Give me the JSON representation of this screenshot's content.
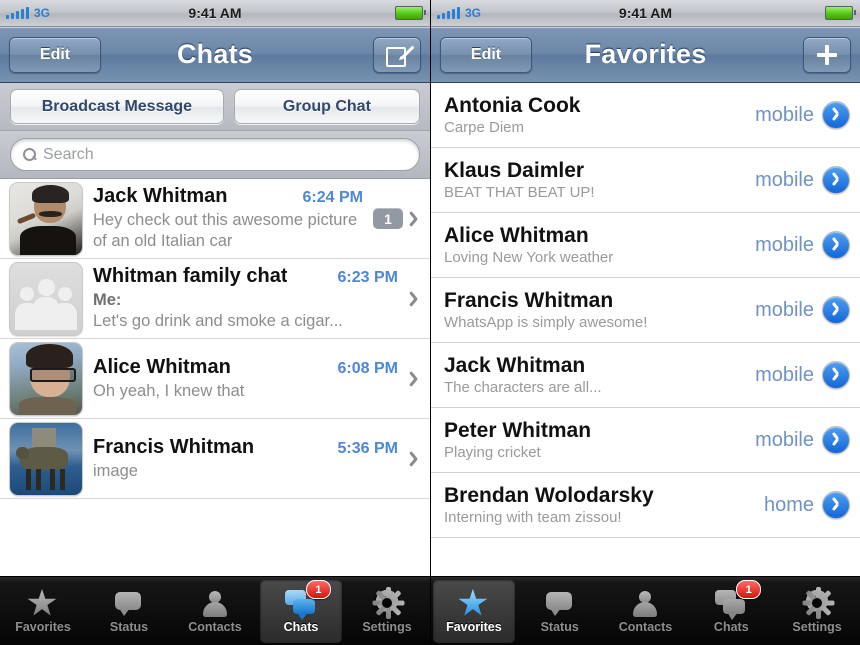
{
  "left_phone": {
    "status_bar": {
      "carrier_network": "3G",
      "time": "9:41 AM"
    },
    "nav": {
      "left_button": "Edit",
      "title": "Chats",
      "right_button_icon": "compose-icon"
    },
    "actions": {
      "broadcast": "Broadcast Message",
      "group": "Group Chat"
    },
    "search": {
      "placeholder": "Search",
      "value": ""
    },
    "chats": [
      {
        "name": "Jack Whitman",
        "time": "6:24 PM",
        "preview": "Hey check out this awesome picture of an old Italian car",
        "sender": "",
        "badge": "1",
        "avatar": "jack"
      },
      {
        "name": "Whitman family chat",
        "time": "6:23 PM",
        "preview": "Let's go drink and smoke a cigar...",
        "sender": "Me:",
        "badge": "",
        "avatar": "group"
      },
      {
        "name": "Alice Whitman",
        "time": "6:08 PM",
        "preview": "Oh yeah, I knew that",
        "sender": "",
        "badge": "",
        "avatar": "alice"
      },
      {
        "name": "Francis Whitman",
        "time": "5:36 PM",
        "preview": "image",
        "sender": "",
        "badge": "",
        "avatar": "francis"
      }
    ],
    "tabs": [
      {
        "label": "Favorites",
        "icon": "star-icon",
        "active": false,
        "badge": ""
      },
      {
        "label": "Status",
        "icon": "speech-bubble-icon",
        "active": false,
        "badge": ""
      },
      {
        "label": "Contacts",
        "icon": "person-icon",
        "active": false,
        "badge": ""
      },
      {
        "label": "Chats",
        "icon": "chats-icon",
        "active": true,
        "badge": "1"
      },
      {
        "label": "Settings",
        "icon": "gear-icon",
        "active": false,
        "badge": ""
      }
    ]
  },
  "right_phone": {
    "status_bar": {
      "carrier_network": "3G",
      "time": "9:41 AM"
    },
    "nav": {
      "left_button": "Edit",
      "title": "Favorites",
      "right_button_icon": "plus-icon"
    },
    "favorites": [
      {
        "name": "Antonia Cook",
        "status": "Carpe Diem",
        "label": "mobile"
      },
      {
        "name": "Klaus Daimler",
        "status": "BEAT THAT BEAT UP!",
        "label": "mobile"
      },
      {
        "name": "Alice Whitman",
        "status": "Loving New York weather",
        "label": "mobile"
      },
      {
        "name": "Francis Whitman",
        "status": "WhatsApp is simply awesome!",
        "label": "mobile"
      },
      {
        "name": "Jack Whitman",
        "status": "The characters are all...",
        "label": "mobile"
      },
      {
        "name": "Peter Whitman",
        "status": "Playing cricket",
        "label": "mobile"
      },
      {
        "name": "Brendan Wolodarsky",
        "status": "Interning with team zissou!",
        "label": "home"
      }
    ],
    "tabs": [
      {
        "label": "Favorites",
        "icon": "star-icon",
        "active": true,
        "badge": ""
      },
      {
        "label": "Status",
        "icon": "speech-bubble-icon",
        "active": false,
        "badge": ""
      },
      {
        "label": "Contacts",
        "icon": "person-icon",
        "active": false,
        "badge": ""
      },
      {
        "label": "Chats",
        "icon": "chats-icon",
        "active": false,
        "badge": "1"
      },
      {
        "label": "Settings",
        "icon": "gear-icon",
        "active": false,
        "badge": ""
      }
    ]
  },
  "theme": {
    "nav_blue": "#6c87a9",
    "time_blue": "#4d87d8",
    "label_blue": "#6f93c4",
    "disclosure_blue": "#1267d8",
    "badge_red": "#d3160f",
    "signal_blue": "#2a7fd4"
  }
}
